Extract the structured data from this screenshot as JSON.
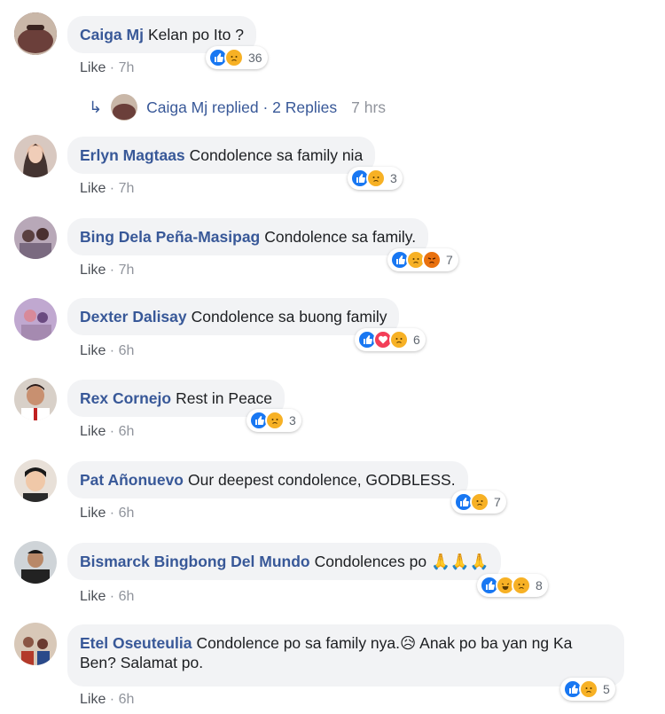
{
  "comments": [
    {
      "author": "Caiga Mj",
      "text": "Kelan po Ito ?",
      "like": "Like",
      "time": "7h",
      "count": "36",
      "reactions": [
        "like",
        "sad"
      ],
      "avatar_color": "#6b3f3a"
    },
    {
      "author": "Erlyn Magtaas",
      "text": "Condolence sa family nia",
      "like": "Like",
      "time": "7h",
      "count": "3",
      "reactions": [
        "like",
        "sad"
      ],
      "avatar_color": "#3a2a28"
    },
    {
      "author": "Bing Dela Peña-Masipag",
      "text": "Condolence sa family.",
      "like": "Like",
      "time": "7h",
      "count": "7",
      "reactions": [
        "like",
        "sad",
        "angry"
      ],
      "avatar_color": "#7a6a80"
    },
    {
      "author": "Dexter Dalisay",
      "text": "Condolence sa buong family",
      "like": "Like",
      "time": "6h",
      "count": "6",
      "reactions": [
        "like",
        "love",
        "sad"
      ],
      "avatar_color": "#a58ab0"
    },
    {
      "author": "Rex Cornejo",
      "text": "Rest in Peace",
      "like": "Like",
      "time": "6h",
      "count": "3",
      "reactions": [
        "like",
        "sad"
      ],
      "avatar_color": "#8a5544"
    },
    {
      "author": "Pat Añonuevo",
      "text": "Our deepest condolence, GODBLESS.",
      "like": "Like",
      "time": "6h",
      "count": "7",
      "reactions": [
        "like",
        "sad"
      ],
      "avatar_color": "#c9a890"
    },
    {
      "author": "Bismarck Bingbong Del Mundo",
      "text": "Condolences po 🙏🙏🙏",
      "like": "Like",
      "time": "6h",
      "count": "8",
      "reactions": [
        "like",
        "haha",
        "sad"
      ],
      "avatar_color": "#5a6470"
    },
    {
      "author": "Etel Oseuteulia",
      "text": "Condolence po sa family nya.😥 Anak po ba yan ng Ka Ben? Salamat po.",
      "like": "Like",
      "time": "6h",
      "count": "5",
      "reactions": [
        "like",
        "sad"
      ],
      "avatar_color": "#b35a4a"
    }
  ],
  "reply_thread": {
    "author": "Caiga Mj",
    "action": "replied",
    "separator": "·",
    "replies": "2 Replies",
    "time": "7 hrs"
  },
  "colors": {
    "like": "#1877f2",
    "sad": "#f7b125",
    "angry": "#e9710f",
    "love": "#f33e58",
    "link": "#385898"
  }
}
